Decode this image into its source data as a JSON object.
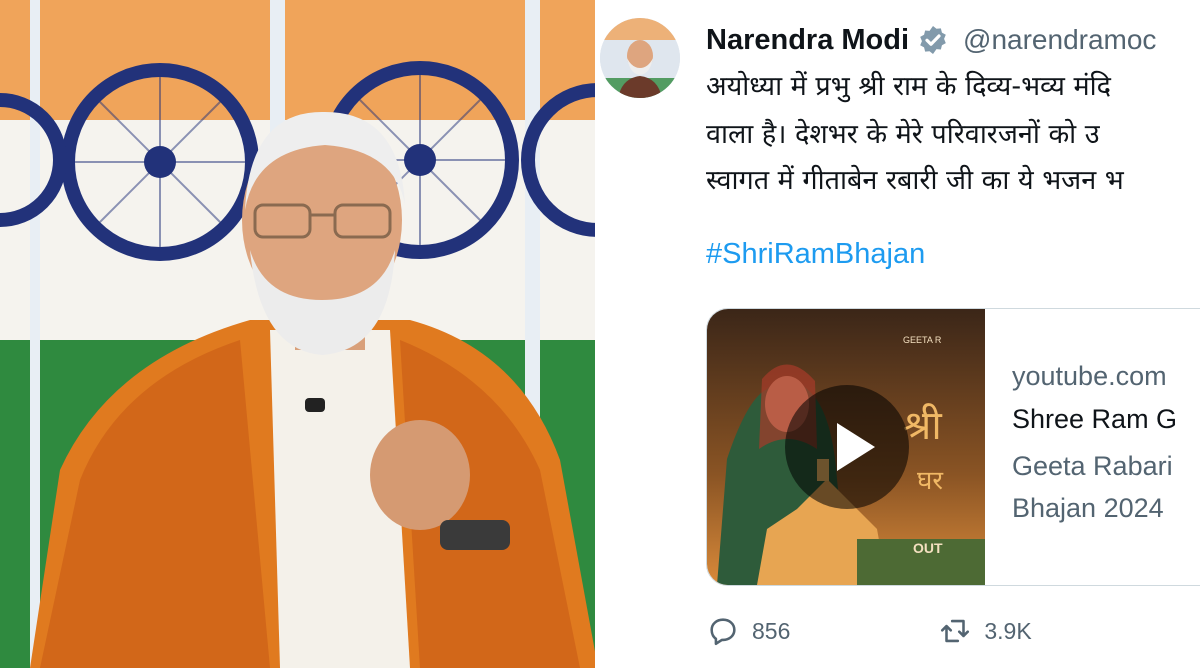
{
  "tweet": {
    "author_name": "Narendra Modi",
    "handle": "@narendramoc",
    "body_lines": [
      "अयोध्या में प्रभु श्री राम के दिव्य-भव्य मंदि",
      "वाला है। देशभर के मेरे परिवारजनों को उ",
      "स्वागत में गीताबेन रबारी जी का ये भजन भ"
    ],
    "hashtag": "#ShriRamBhajan",
    "card": {
      "domain": "youtube.com",
      "title": "Shree Ram G",
      "description_lines": [
        "Geeta Rabari",
        "Bhajan 2024"
      ],
      "thumbnail_lettering": [
        "श्री",
        "घर",
        "OUT",
        "GEETA R"
      ]
    },
    "replies": "856",
    "reposts": "3.9K"
  },
  "colors": {
    "link": "#1d9bf0",
    "secondary_text": "#536471",
    "primary_text": "#0f1419",
    "verified": "#829aab"
  },
  "icons": {
    "verified": "verified-badge-icon",
    "reply": "reply-icon",
    "repost": "repost-icon",
    "play": "play-icon"
  }
}
